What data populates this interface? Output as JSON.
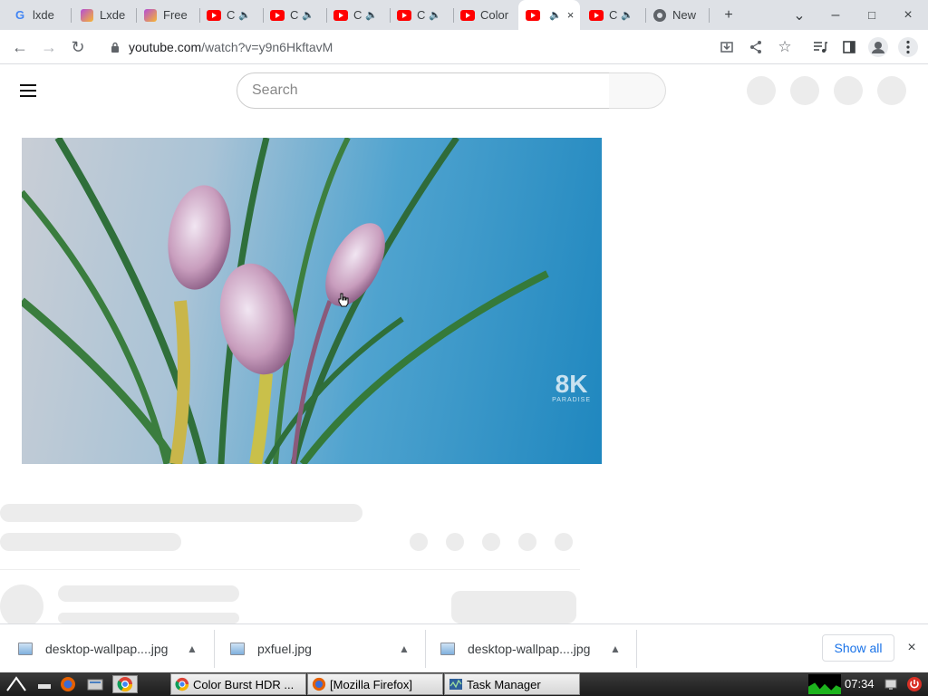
{
  "browser": {
    "tabs": [
      {
        "title": "lxde",
        "favicon": "google-icon"
      },
      {
        "title": "Lxde",
        "favicon": "picsart-icon"
      },
      {
        "title": "Free",
        "favicon": "picsart-icon"
      },
      {
        "title": "C",
        "favicon": "youtube-icon",
        "audio": true
      },
      {
        "title": "C",
        "favicon": "youtube-icon",
        "audio": true
      },
      {
        "title": "C",
        "favicon": "youtube-icon",
        "audio": true
      },
      {
        "title": "C",
        "favicon": "youtube-icon",
        "audio": true
      },
      {
        "title": "Color",
        "favicon": "youtube-icon"
      },
      {
        "title": "",
        "favicon": "youtube-icon",
        "audio": true,
        "active": true,
        "close": "×"
      },
      {
        "title": "C",
        "favicon": "youtube-icon",
        "audio": true
      },
      {
        "title": "New",
        "favicon": "chrome-icon"
      }
    ],
    "new_tab": "+",
    "window_controls": {
      "menu": "⌄",
      "minimize": "–",
      "maximize": "□",
      "close": "×"
    },
    "toolbar": {
      "back": "←",
      "forward": "→",
      "reload": "↻"
    },
    "url": {
      "host": "youtube.com",
      "path": "/watch?v=y9n6HkftavM"
    },
    "toolbar_icons": [
      "install-icon",
      "share-icon",
      "bookmark-star-icon",
      "media-control-icon",
      "side-panel-icon",
      "profile-icon",
      "menu-icon"
    ]
  },
  "youtube": {
    "search_placeholder": "Search",
    "video_watermark": {
      "big": "8K",
      "small": "PARADISE"
    }
  },
  "downloads": {
    "items": [
      {
        "name": "desktop-wallpap....jpg"
      },
      {
        "name": "pxfuel.jpg"
      },
      {
        "name": "desktop-wallpap....jpg"
      }
    ],
    "show_all": "Show all",
    "close": "×"
  },
  "taskbar": {
    "tasks": [
      {
        "label": "Color Burst HDR ..."
      },
      {
        "label": "[Mozilla Firefox]"
      },
      {
        "label": "Task Manager"
      }
    ],
    "clock": "07:34"
  },
  "colors": {
    "youtube_red": "#ff0000",
    "link_blue": "#1a73e8",
    "tab_strip": "#dee1e6"
  }
}
